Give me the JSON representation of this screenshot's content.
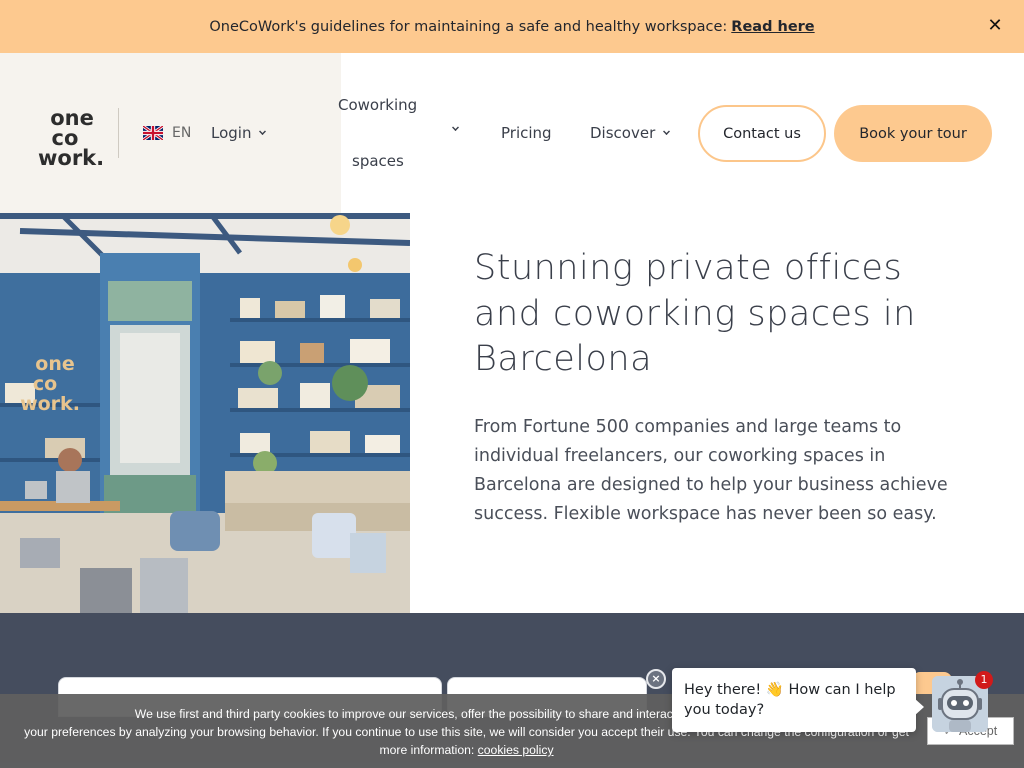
{
  "announcement": {
    "text": "OneCoWork's guidelines for maintaining a safe and healthy workspace:",
    "link": "Read here",
    "close": "✕"
  },
  "header": {
    "logo": [
      "one",
      "co",
      "work."
    ],
    "language": "EN",
    "login": "Login",
    "nav": {
      "coworking_line1": "Coworking",
      "coworking_line2": "spaces",
      "pricing": "Pricing",
      "discover": "Discover"
    },
    "contact_button": "Contact us",
    "tour_button": "Book your tour"
  },
  "hero": {
    "title": "Stunning private offices and coworking spaces in Barcelona",
    "text": "From Fortune 500 companies and large teams to individual freelancers, our coworking spaces in Barcelona are designed to help your business achieve success. Flexible workspace has never been so easy.",
    "image_sign": [
      "one",
      "co",
      "work."
    ]
  },
  "cookie": {
    "line1": "We use first and third party cookies to improve our services, offer the possibility to share and interact with social networks a",
    "line2": "your preferences by analyzing your browsing behavior. If you continue to use this site, we will consider you accept their use. You can change the configuration or get",
    "line3_prefix": "more information:",
    "policy_link": "cookies policy",
    "accept": "Accept"
  },
  "chat": {
    "close": "×",
    "message": "Hey there! 👋 How can I help you today?",
    "badge": "1"
  },
  "colors": {
    "accent": "#fdc98f",
    "dark_section": "#454d5e",
    "header_left_bg": "#f6f3ee",
    "text": "#3a3f4a"
  }
}
